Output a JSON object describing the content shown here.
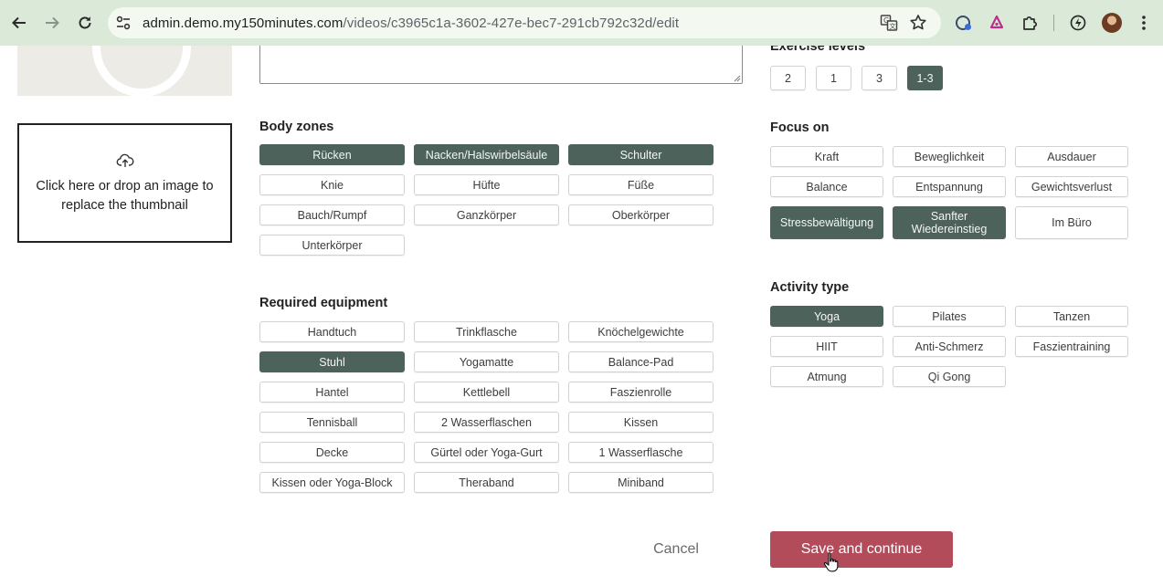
{
  "browser": {
    "url_host": "admin.demo.my150minutes.com",
    "url_path": "/videos/c3965c1a-3602-427e-bec7-291cb792c32d/edit"
  },
  "thumbnail": {
    "dropzone_text": "Click here or drop an image to replace the thumbnail"
  },
  "body_zones": {
    "title": "Body zones",
    "items": [
      {
        "label": "Rücken",
        "selected": true
      },
      {
        "label": "Nacken/Halswirbelsäule",
        "selected": true
      },
      {
        "label": "Schulter",
        "selected": true
      },
      {
        "label": "Knie",
        "selected": false
      },
      {
        "label": "Hüfte",
        "selected": false
      },
      {
        "label": "Füße",
        "selected": false
      },
      {
        "label": "Bauch/Rumpf",
        "selected": false
      },
      {
        "label": "Ganzkörper",
        "selected": false
      },
      {
        "label": "Oberkörper",
        "selected": false
      },
      {
        "label": "Unterkörper",
        "selected": false
      }
    ]
  },
  "required_equipment": {
    "title": "Required equipment",
    "items": [
      {
        "label": "Handtuch",
        "selected": false
      },
      {
        "label": "Trinkflasche",
        "selected": false
      },
      {
        "label": "Knöchelgewichte",
        "selected": false
      },
      {
        "label": "Stuhl",
        "selected": true
      },
      {
        "label": "Yogamatte",
        "selected": false
      },
      {
        "label": "Balance-Pad",
        "selected": false
      },
      {
        "label": "Hantel",
        "selected": false
      },
      {
        "label": "Kettlebell",
        "selected": false
      },
      {
        "label": "Faszienrolle",
        "selected": false
      },
      {
        "label": "Tennisball",
        "selected": false
      },
      {
        "label": "2 Wasserflaschen",
        "selected": false
      },
      {
        "label": "Kissen",
        "selected": false
      },
      {
        "label": "Decke",
        "selected": false
      },
      {
        "label": "Gürtel oder Yoga-Gurt",
        "selected": false
      },
      {
        "label": "1 Wasserflasche",
        "selected": false
      },
      {
        "label": "Kissen oder Yoga-Block",
        "selected": false
      },
      {
        "label": "Theraband",
        "selected": false
      },
      {
        "label": "Miniband",
        "selected": false
      }
    ]
  },
  "exercise_levels": {
    "title": "Exercise levels",
    "items": [
      {
        "label": "2",
        "selected": false
      },
      {
        "label": "1",
        "selected": false
      },
      {
        "label": "3",
        "selected": false
      },
      {
        "label": "1-3",
        "selected": true
      }
    ]
  },
  "focus_on": {
    "title": "Focus on",
    "items": [
      {
        "label": "Kraft",
        "selected": false
      },
      {
        "label": "Beweglichkeit",
        "selected": false
      },
      {
        "label": "Ausdauer",
        "selected": false
      },
      {
        "label": "Balance",
        "selected": false
      },
      {
        "label": "Entspannung",
        "selected": false
      },
      {
        "label": "Gewichtsverlust",
        "selected": false
      },
      {
        "label": "Stressbewältigung",
        "selected": true
      },
      {
        "label": "Sanfter Wiedereinstieg",
        "selected": true
      },
      {
        "label": "Im Büro",
        "selected": false
      }
    ]
  },
  "activity_type": {
    "title": "Activity type",
    "items": [
      {
        "label": "Yoga",
        "selected": true
      },
      {
        "label": "Pilates",
        "selected": false
      },
      {
        "label": "Tanzen",
        "selected": false
      },
      {
        "label": "HIIT",
        "selected": false
      },
      {
        "label": "Anti-Schmerz",
        "selected": false
      },
      {
        "label": "Faszientraining",
        "selected": false
      },
      {
        "label": "Atmung",
        "selected": false
      },
      {
        "label": "Qi Gong",
        "selected": false
      }
    ]
  },
  "footer": {
    "cancel_label": "Cancel",
    "save_label": "Save and continue"
  },
  "colors": {
    "selected_chip": "#4d625a",
    "save_button": "#b24c5a",
    "browser_bar": "#dbe9d8"
  }
}
